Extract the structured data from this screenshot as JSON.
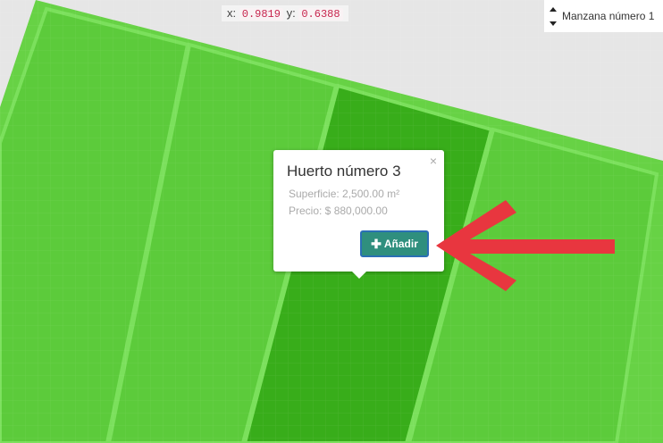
{
  "coordinates": {
    "x_label": "x:",
    "x_value": "0.9819",
    "y_label": "y:",
    "y_value": "0.6388"
  },
  "block_selector": {
    "value": "Manzana número 1"
  },
  "popup": {
    "title": "Huerto número 3",
    "area": "Superficie: 2,500.00 m²",
    "price": "Precio: $ 880,000.00",
    "add_label": "Añadir",
    "close_glyph": "×"
  },
  "colors": {
    "lot": "#5ccb3b",
    "lot_selected": "#38ad1a",
    "lot_border": "#7be05c",
    "button": "#2f8f7e",
    "arrow": "#e8363f"
  },
  "icons": [
    "plus-icon",
    "close-icon",
    "sort-arrows-icon",
    "red-arrow-icon"
  ]
}
